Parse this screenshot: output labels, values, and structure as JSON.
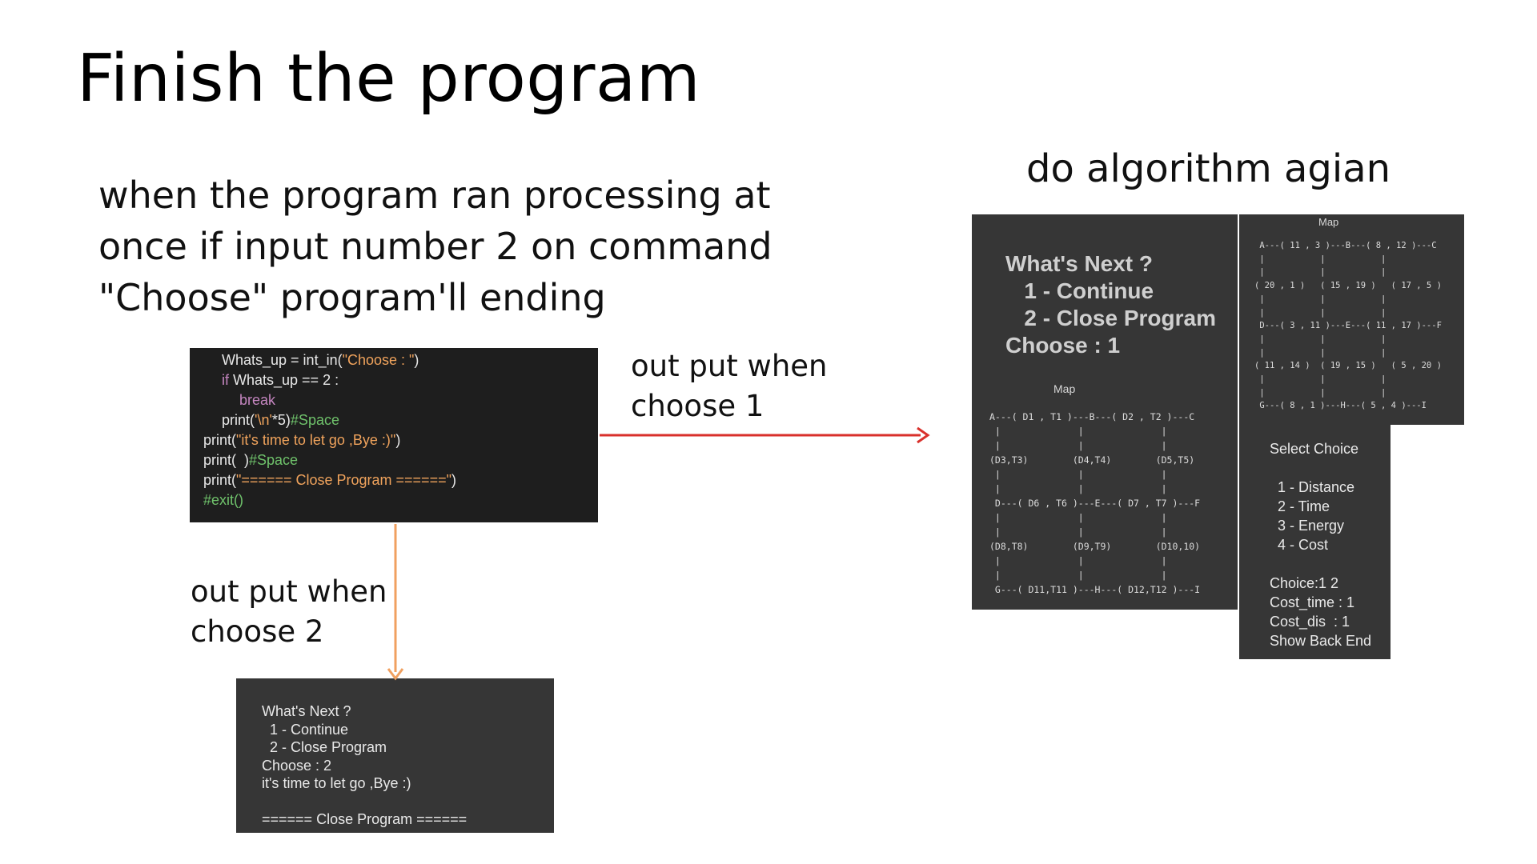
{
  "title": "Finish the program",
  "description": {
    "lines": [
      "when the program ran processing at",
      "once if input number 2 on command",
      "\"Choose\" program'll ending"
    ]
  },
  "right_title": "do algorithm agian",
  "labels": {
    "choose1": [
      "out put when",
      "choose 1"
    ],
    "choose2": [
      "out put when",
      "choose 2"
    ]
  },
  "code": {
    "lines": [
      [
        {
          "t": "Whats_up = int_in(",
          "c": "#e8e8e8"
        },
        {
          "t": "\"Choose : \"",
          "c": "#f0a35c"
        },
        {
          "t": ")",
          "c": "#e8e8e8"
        }
      ],
      [
        {
          "t": "if",
          "c": "#c586c0"
        },
        {
          "t": " Whats_up == 2 :",
          "c": "#e8e8e8"
        }
      ],
      [
        {
          "t": "break",
          "c": "#c586c0"
        }
      ],
      [
        {
          "t": "print(",
          "c": "#e8e8e8"
        },
        {
          "t": "'\\n'",
          "c": "#f0a35c"
        },
        {
          "t": "*5)",
          "c": "#e8e8e8"
        },
        {
          "t": "#Space",
          "c": "#6fc26b"
        }
      ],
      [
        {
          "t": "print(",
          "c": "#e8e8e8"
        },
        {
          "t": "\"it's time to let go ,Bye :)\"",
          "c": "#f0a35c"
        },
        {
          "t": ")",
          "c": "#e8e8e8"
        }
      ],
      [
        {
          "t": "print(  )",
          "c": "#e8e8e8"
        },
        {
          "t": "#Space",
          "c": "#6fc26b"
        }
      ],
      [
        {
          "t": "print(",
          "c": "#e8e8e8"
        },
        {
          "t": "\"====== Close Program ======\"",
          "c": "#f0a35c"
        },
        {
          "t": ")",
          "c": "#e8e8e8"
        }
      ],
      [
        {
          "t": "#exit()",
          "c": "#6fc26b"
        }
      ]
    ]
  },
  "output_choose2": {
    "lines": [
      "What's Next ?",
      "  1 - Continue",
      "  2 - Close Program",
      "Choose : 2",
      "it's time to let go ,Bye :)",
      "",
      "====== Close Program ======"
    ]
  },
  "output_choose1": {
    "menu_lines": [
      "What's Next ?",
      "   1 - Continue",
      "   2 - Close Program",
      "Choose : 1"
    ],
    "map_title": "Map",
    "map_ascii": "A---( D1 , T1 )---B---( D2 , T2 )---C\n |              |              |\n |              |              |\n(D3,T3)        (D4,T4)        (D5,T5)\n |              |              |\n |              |              |\n D---( D6 , T6 )---E---( D7 , T7 )---F\n |              |              |\n |              |              |\n(D8,T8)        (D9,T9)        (D10,10)\n |              |              |\n |              |              |\n G---( D11,T11 )---H---( D12,T12 )---I"
  },
  "map_values": {
    "title": "Map",
    "ascii": " A---( 11 , 3 )---B---( 8 , 12 )---C\n |           |           |\n |           |           |\n( 20 , 1 )   ( 15 , 19 )   ( 17 , 5 )\n |           |           |\n |           |           |\n D---( 3 , 11 )---E---( 11 , 17 )---F\n |           |           |\n |           |           |\n( 11 , 14 )  ( 19 , 15 )   ( 5 , 20 )\n |           |           |\n |           |           |\n G---( 8 , 1 )---H---( 5 , 4 )---I"
  },
  "select_choice": {
    "lines": [
      "Select Choice",
      "",
      "  1 - Distance",
      "  2 - Time",
      "  3 - Energy",
      "  4 - Cost",
      "",
      "Choice:1 2",
      "Cost_time : 1",
      "Cost_dis  : 1",
      "Show Back End"
    ]
  },
  "colors": {
    "arrow_red": "#d9302b",
    "arrow_orange": "#f0a060",
    "terminal_bg": "#363636",
    "editor_bg": "#1e1e1e"
  }
}
